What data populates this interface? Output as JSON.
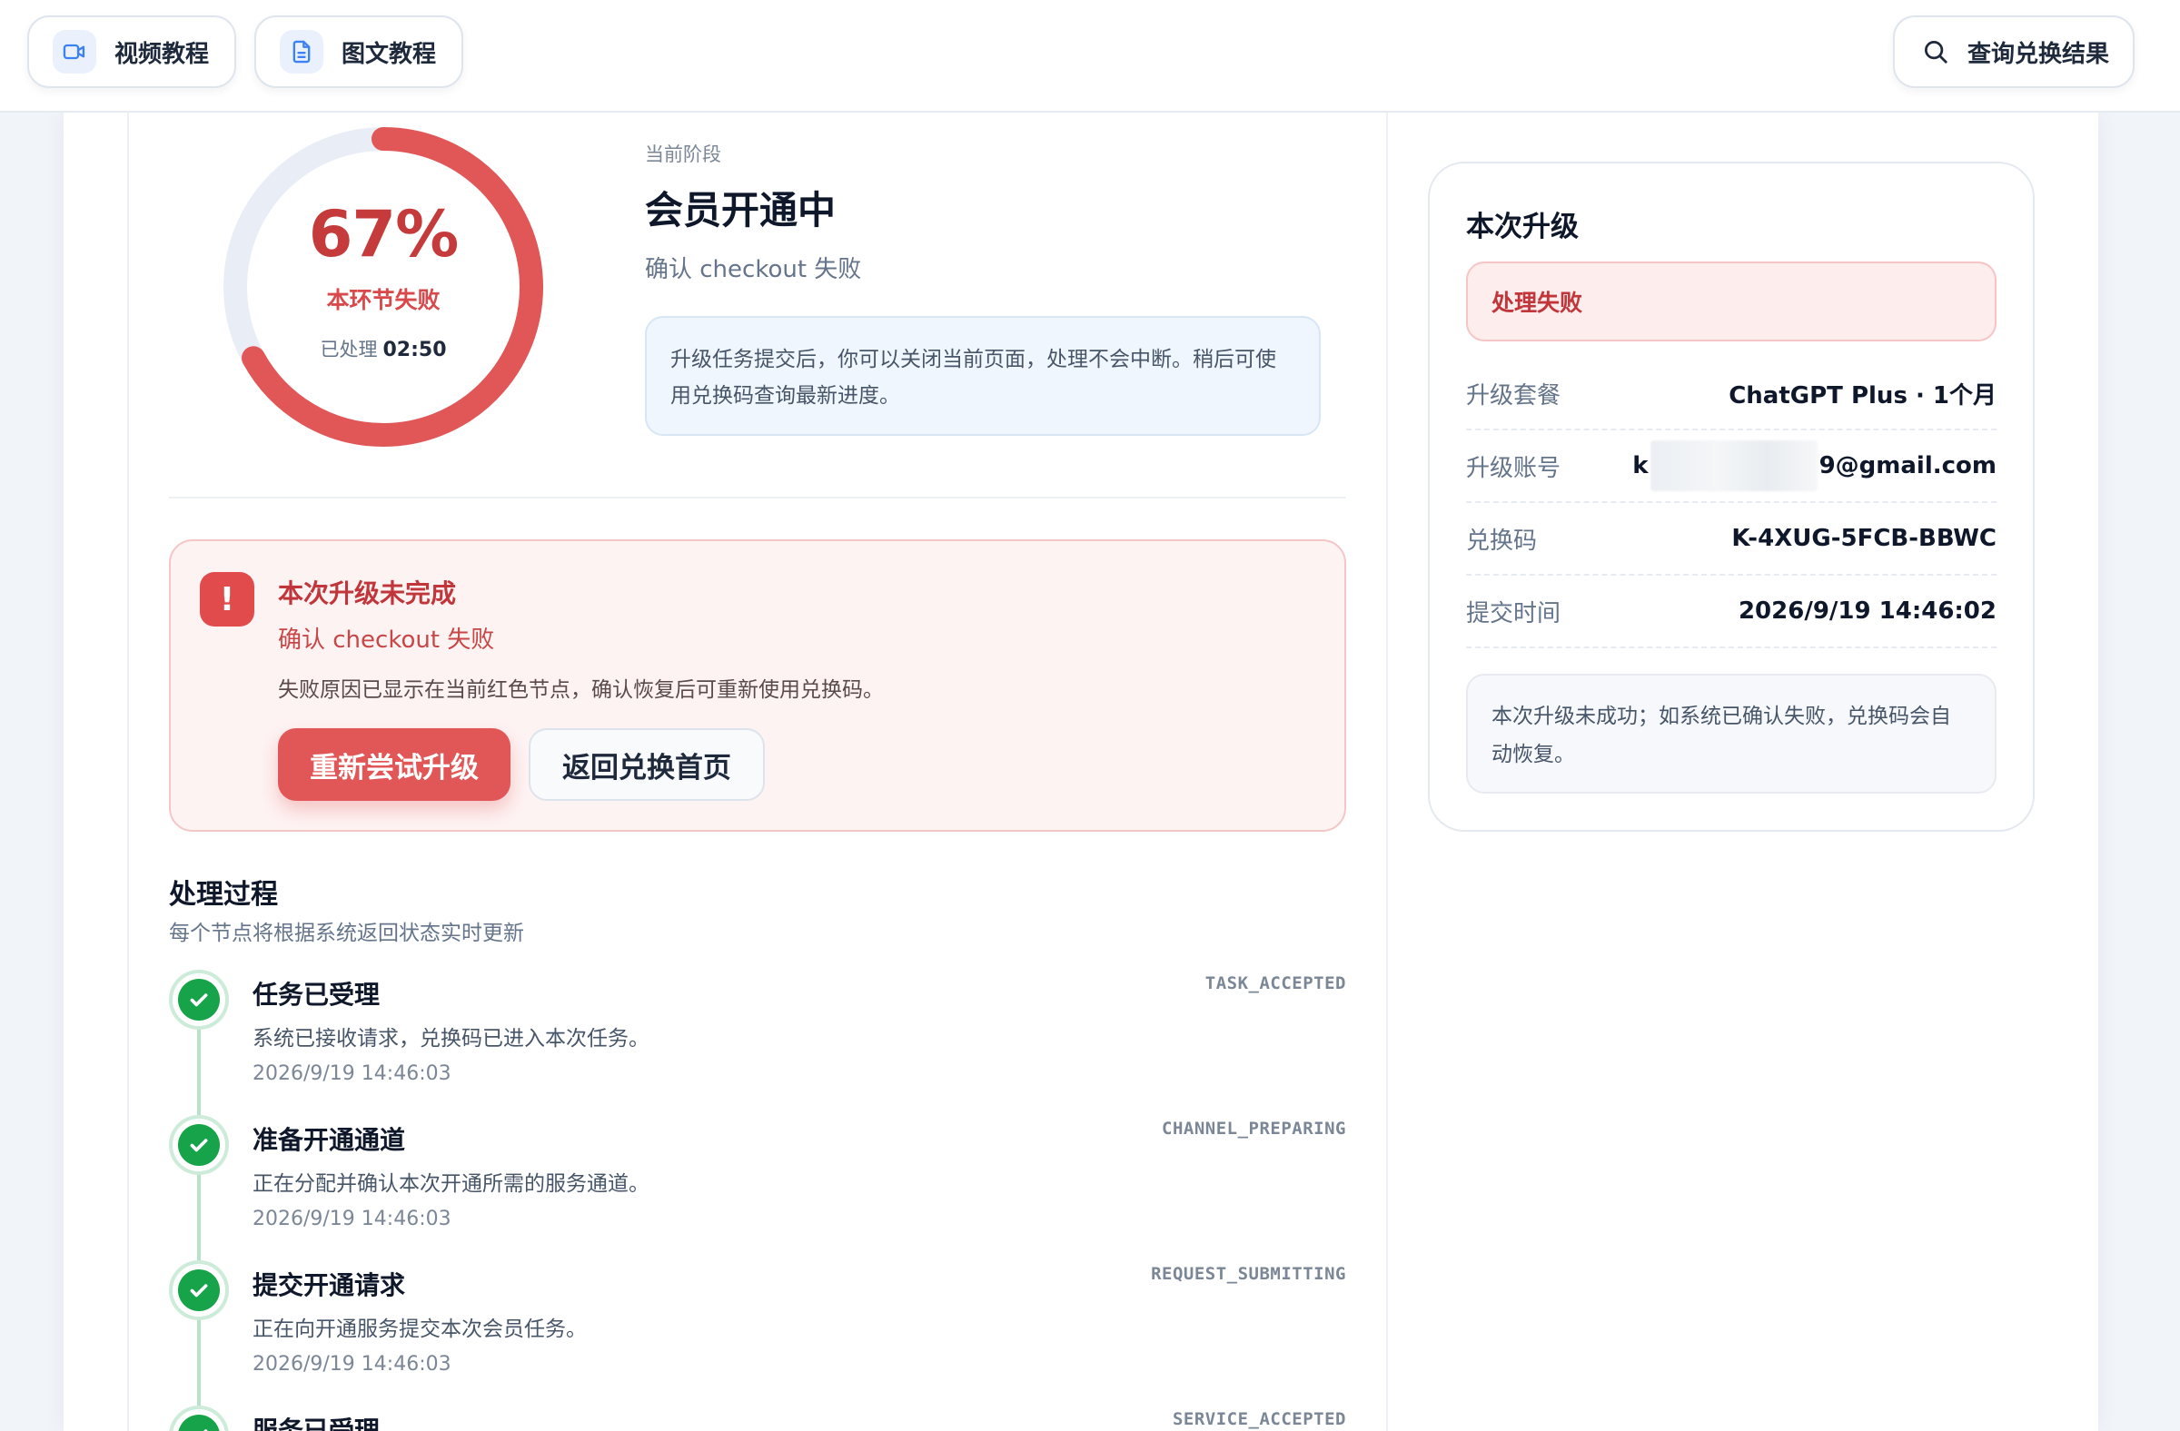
{
  "toolbar": {
    "video_label": "视频教程",
    "doc_label": "图文教程",
    "query_label": "查询兑换结果"
  },
  "progress": {
    "percent_text": "67%",
    "fraction": 0.67,
    "status": "本环节失败",
    "elapsed_label": "已处理",
    "elapsed_value": "02:50"
  },
  "stage": {
    "label": "当前阶段",
    "title": "会员开通中",
    "subtitle": "确认 checkout 失败",
    "note": "升级任务提交后，你可以关闭当前页面，处理不会中断。稍后可使用兑换码查询最新进度。"
  },
  "error": {
    "icon": "!",
    "title": "本次升级未完成",
    "subtitle": "确认 checkout 失败",
    "desc": "失败原因已显示在当前红色节点，确认恢复后可重新使用兑换码。",
    "retry_label": "重新尝试升级",
    "home_label": "返回兑换首页"
  },
  "process": {
    "title": "处理过程",
    "subtitle": "每个节点将根据系统返回状态实时更新",
    "steps": [
      {
        "name": "任务已受理",
        "desc": "系统已接收请求，兑换码已进入本次任务。",
        "time": "2026/9/19 14:46:03",
        "code": "TASK_ACCEPTED"
      },
      {
        "name": "准备开通通道",
        "desc": "正在分配并确认本次开通所需的服务通道。",
        "time": "2026/9/19 14:46:03",
        "code": "CHANNEL_PREPARING"
      },
      {
        "name": "提交开通请求",
        "desc": "正在向开通服务提交本次会员任务。",
        "time": "2026/9/19 14:46:03",
        "code": "REQUEST_SUBMITTING"
      },
      {
        "name": "服务已受理",
        "desc": "",
        "time": "",
        "code": "SERVICE_ACCEPTED"
      }
    ]
  },
  "summary": {
    "title": "本次升级",
    "badge": "处理失败",
    "plan_label": "升级套餐",
    "plan_value": "ChatGPT Plus · 1个月",
    "account_label": "升级账号",
    "account_prefix": "k",
    "account_suffix": "9@gmail.com",
    "code_label": "兑换码",
    "code_value": "K-4XUG-5FCB-BBWC",
    "time_label": "提交时间",
    "time_value": "2026/9/19 14:46:02",
    "foot_note": "本次升级未成功；如系统已确认失败，兑换码会自动恢复。"
  },
  "colors": {
    "accent_red": "#e15656",
    "success_green": "#16a34a",
    "ring_track": "#e9eef6"
  }
}
